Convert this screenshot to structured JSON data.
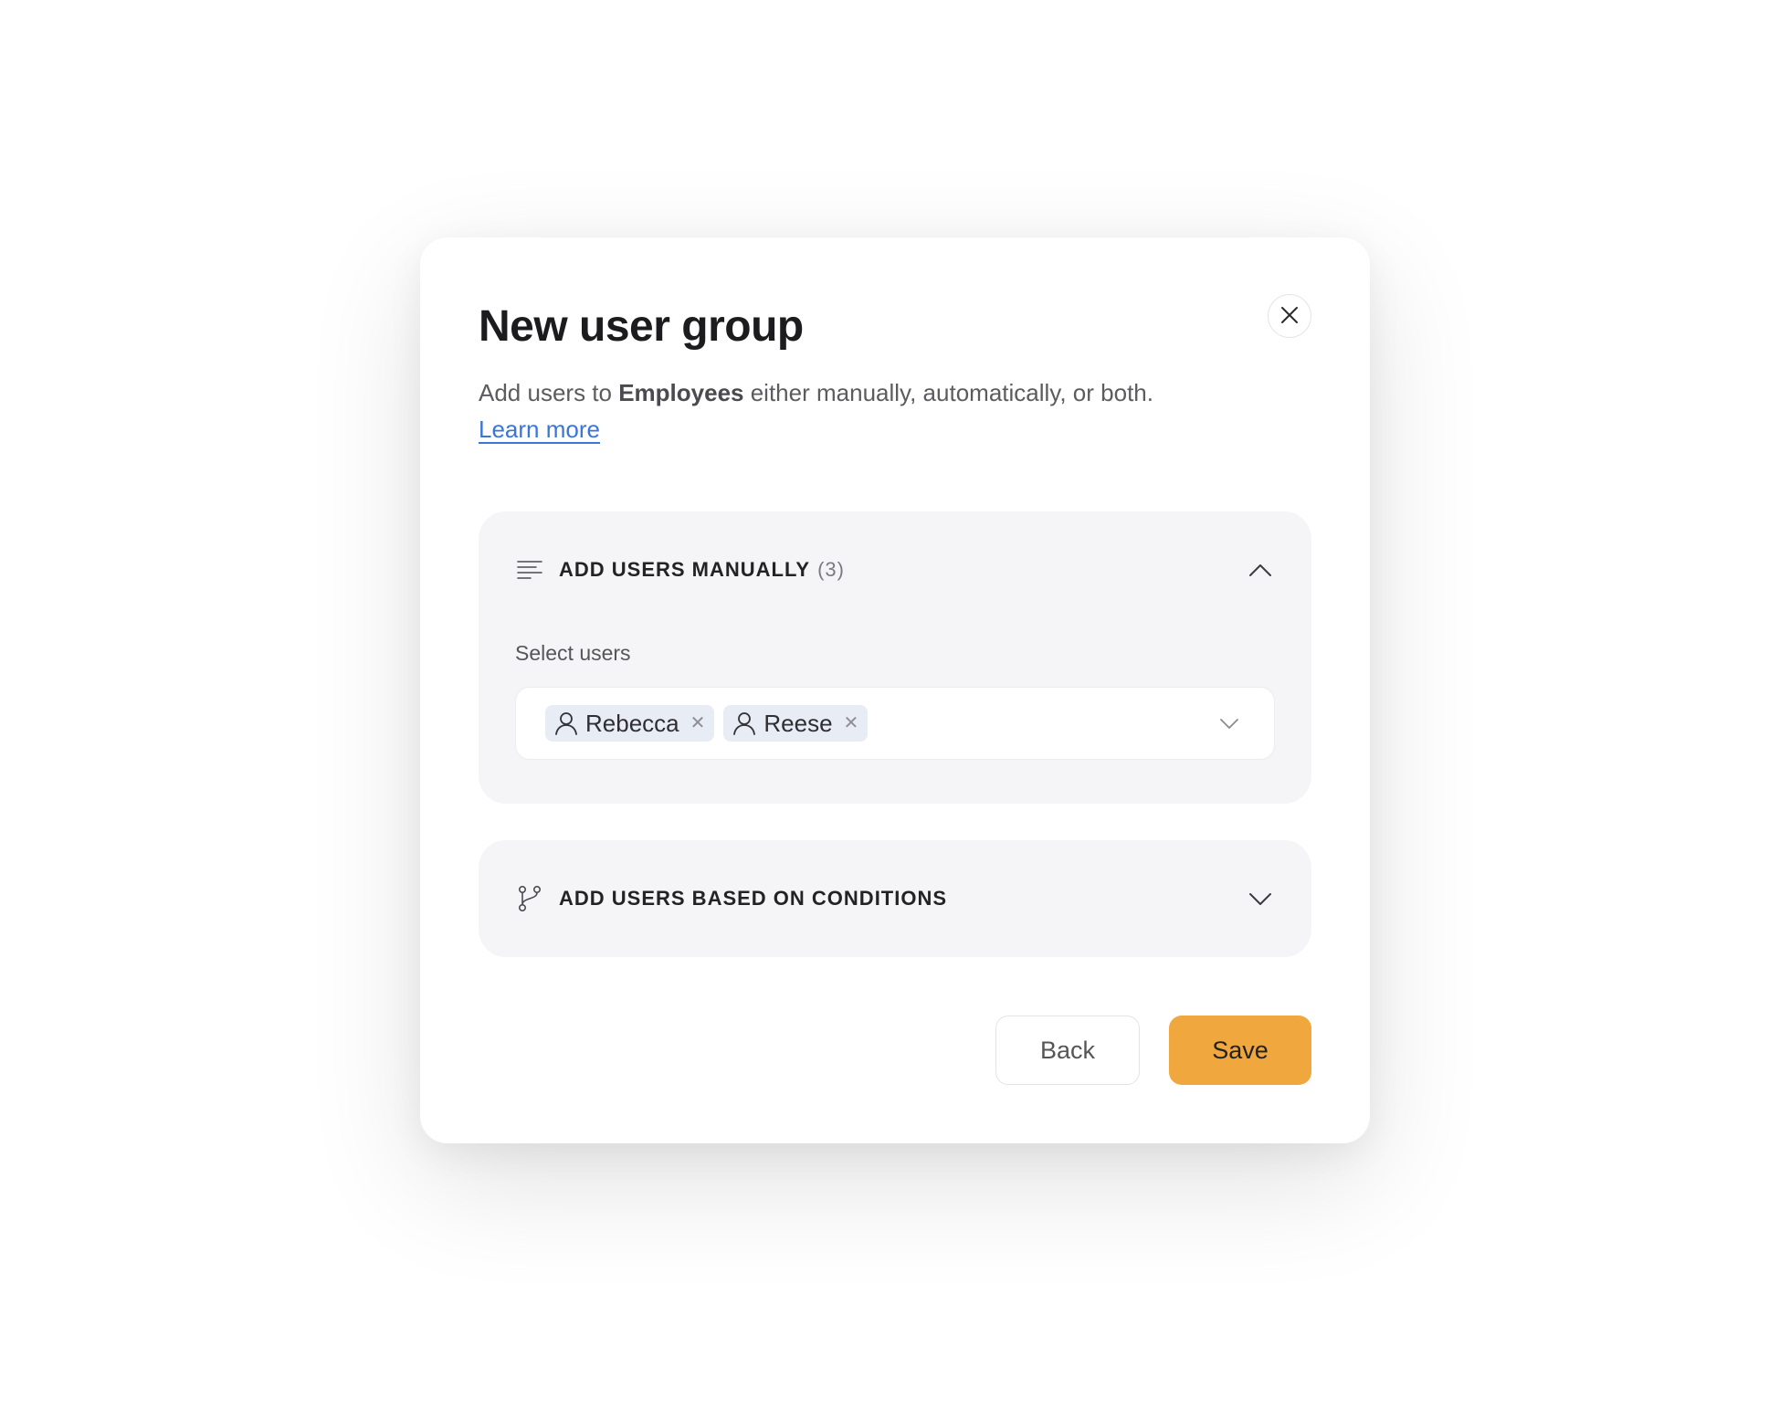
{
  "colors": {
    "accent": "#f0a73e",
    "link": "#3a76d6",
    "panel_bg": "#f5f5f7",
    "chip_bg": "#e8ecf4"
  },
  "dialog": {
    "title": "New user group",
    "subtitle_prefix": "Add users to ",
    "group_name": "Employees",
    "subtitle_suffix": " either manually, automatically, or both.",
    "learn_more": "Learn more",
    "close_icon": "close-icon"
  },
  "manual_section": {
    "icon": "list-icon",
    "title": "ADD USERS MANUALLY",
    "count": "(3)",
    "expanded": true,
    "field_label": "Select users",
    "selected_users": [
      {
        "name": "Rebecca",
        "icon": "user-icon"
      },
      {
        "name": "Reese",
        "icon": "user-icon"
      }
    ]
  },
  "conditions_section": {
    "icon": "branch-icon",
    "title": "ADD USERS BASED ON CONDITIONS",
    "expanded": false
  },
  "footer": {
    "back_label": "Back",
    "save_label": "Save"
  }
}
